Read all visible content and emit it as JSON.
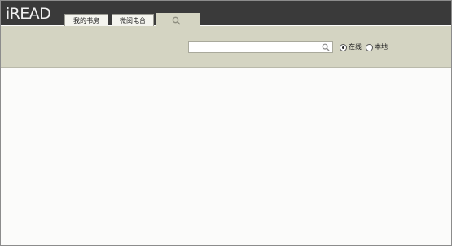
{
  "app": {
    "logo": "iREAD"
  },
  "tabs": [
    {
      "label": "我的书房"
    },
    {
      "label": "微阅电台"
    },
    {
      "icon": "search-icon",
      "active": true
    }
  ],
  "search": {
    "value": "",
    "placeholder": "",
    "icon": "search-icon"
  },
  "source_options": [
    {
      "label": "在线",
      "selected": true
    },
    {
      "label": "本地",
      "selected": false
    }
  ],
  "colors": {
    "titlebar": "#3a3a3a",
    "toolbar": "#d4d4c2",
    "tab": "#f4f4ee",
    "content": "#fbfbfa"
  }
}
